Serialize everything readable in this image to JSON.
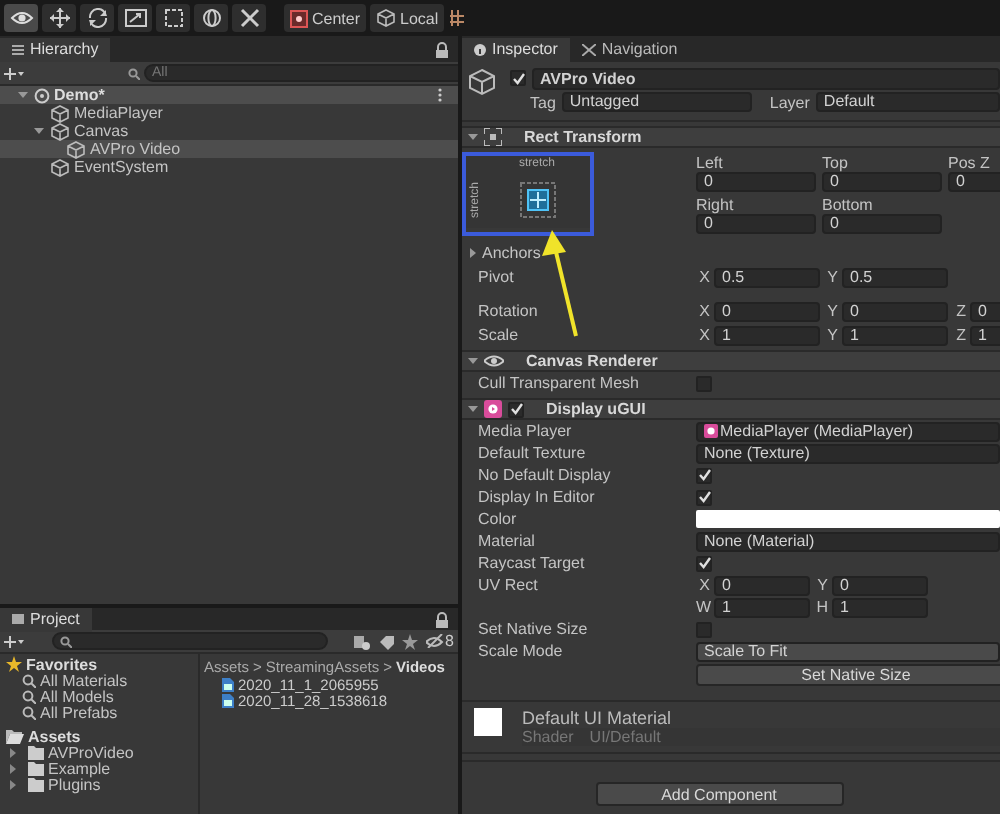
{
  "toolbar": {
    "tools": [
      {
        "kind": "view",
        "selected": true
      },
      {
        "kind": "move",
        "selected": false
      },
      {
        "kind": "rotate",
        "selected": false
      },
      {
        "kind": "scale",
        "selected": false
      },
      {
        "kind": "rect",
        "selected": false
      },
      {
        "kind": "transform",
        "selected": false
      },
      {
        "kind": "custom",
        "selected": false
      }
    ],
    "pivots": [
      {
        "kind": "center",
        "label": "Center"
      },
      {
        "kind": "local",
        "label": "Local"
      }
    ]
  },
  "hierarchy": {
    "title": "Hierarchy",
    "placeholder": "All",
    "tree": [
      {
        "name": "Demo*",
        "kind": "scene",
        "expanded": true,
        "selected": true,
        "children": [
          {
            "name": "MediaPlayer",
            "kind": "object",
            "selected": false
          },
          {
            "name": "Canvas",
            "kind": "object",
            "expanded": true,
            "selected": false,
            "children": [
              {
                "name": "AVPro Video",
                "kind": "object",
                "selected": true
              }
            ]
          },
          {
            "name": "EventSystem",
            "kind": "object",
            "selected": false
          }
        ]
      }
    ]
  },
  "project": {
    "title": "Project",
    "badge": "8",
    "favorites": {
      "label": "Favorites",
      "items": [
        "All Materials",
        "All Models",
        "All Prefabs"
      ]
    },
    "assets": {
      "label": "Assets",
      "children": [
        {
          "name": "AVProVideo",
          "expanded": false
        },
        {
          "name": "Example",
          "expanded": false
        },
        {
          "name": "Plugins",
          "expanded": false
        }
      ]
    },
    "breadcrumb": [
      "Assets",
      "StreamingAssets",
      "Videos"
    ],
    "separator": ">",
    "files": [
      "2020_11_1_2065955",
      "2020_11_28_1538618"
    ]
  },
  "inspector": {
    "tabs": [
      {
        "label": "Inspector",
        "selected": true
      },
      {
        "label": "Navigation",
        "selected": false
      }
    ],
    "object": {
      "active": true,
      "name": "AVPro Video",
      "tag_label": "Tag",
      "tag": "Untagged",
      "layer_label": "Layer",
      "layer": "Default"
    },
    "rect_transform": {
      "title": "Rect Transform",
      "expanded": true,
      "preset_top": "stretch",
      "preset_side": "stretch",
      "offsets": [
        {
          "label": "Left",
          "value": "0"
        },
        {
          "label": "Top",
          "value": "0"
        },
        {
          "label": "Pos Z",
          "value": "0"
        },
        {
          "label": "Right",
          "value": "0"
        },
        {
          "label": "Bottom",
          "value": "0"
        }
      ],
      "anchors": {
        "label": "Anchors",
        "expanded": false
      },
      "vectors": [
        {
          "label": "Pivot",
          "axes": [
            {
              "axis": "X",
              "value": "0.5"
            },
            {
              "axis": "Y",
              "value": "0.5"
            }
          ]
        },
        {
          "label": "Rotation",
          "axes": [
            {
              "axis": "X",
              "value": "0"
            },
            {
              "axis": "Y",
              "value": "0"
            },
            {
              "axis": "Z",
              "value": "0"
            }
          ]
        },
        {
          "label": "Scale",
          "axes": [
            {
              "axis": "X",
              "value": "1"
            },
            {
              "axis": "Y",
              "value": "1"
            },
            {
              "axis": "Z",
              "value": "1"
            }
          ]
        }
      ]
    },
    "canvas_renderer": {
      "title": "Canvas Renderer",
      "expanded": true,
      "rows": [
        {
          "kind": "checkbox",
          "label": "Cull Transparent Mesh",
          "checked": false
        }
      ]
    },
    "display": {
      "title": "Display uGUI",
      "expanded": true,
      "enabled": true,
      "rows": [
        {
          "kind": "ref",
          "label": "Media Player",
          "value": "MediaPlayer (MediaPlayer)"
        },
        {
          "kind": "object",
          "label": "Default Texture",
          "value": "None (Texture)"
        },
        {
          "kind": "checkbox",
          "label": "No Default Display",
          "checked": true
        },
        {
          "kind": "checkbox",
          "label": "Display In Editor",
          "checked": true
        },
        {
          "kind": "color",
          "label": "Color"
        },
        {
          "kind": "object",
          "label": "Material",
          "value": "None (Material)"
        },
        {
          "kind": "checkbox",
          "label": "Raycast Target",
          "checked": true
        },
        {
          "kind": "vector",
          "label": "UV Rect",
          "axes": [
            {
              "axis": "X",
              "value": "0"
            },
            {
              "axis": "Y",
              "value": "0"
            }
          ]
        },
        {
          "kind": "vector",
          "label": "",
          "axes": [
            {
              "axis": "W",
              "value": "1"
            },
            {
              "axis": "H",
              "value": "1"
            }
          ]
        },
        {
          "kind": "checkbox",
          "label": "Set Native Size",
          "checked": false
        },
        {
          "kind": "dropdown",
          "label": "Scale Mode",
          "value": "Scale To Fit"
        },
        {
          "kind": "button",
          "value": "Set Native Size"
        }
      ]
    },
    "material": {
      "name": "Default UI Material",
      "shader_label": "Shader",
      "shader": "UI/Default"
    },
    "add_component": "Add Component"
  },
  "annotation": {
    "highlight_box": true,
    "arrow": true
  }
}
